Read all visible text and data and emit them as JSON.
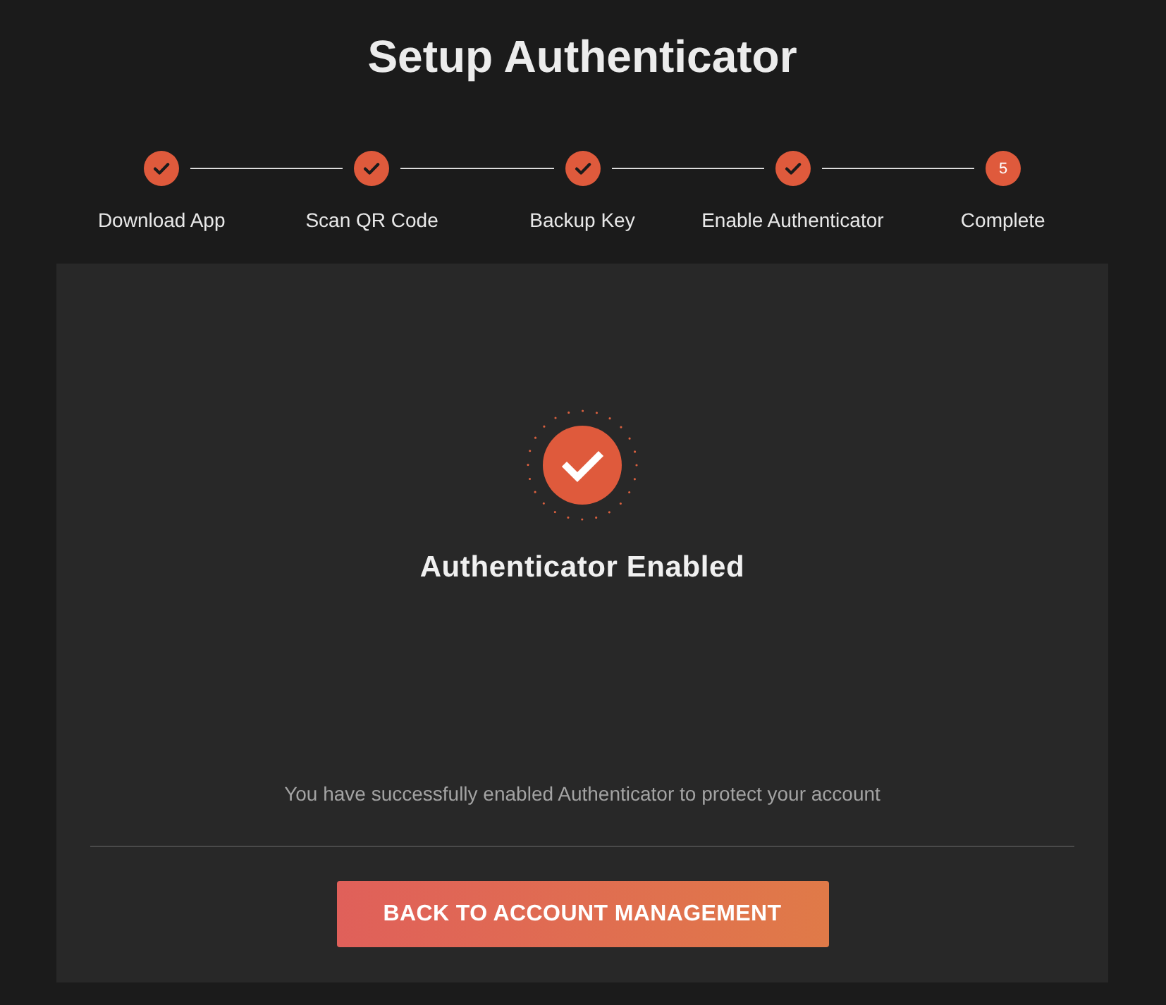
{
  "page": {
    "title": "Setup Authenticator"
  },
  "steps": [
    {
      "label": "Download App",
      "completed": true
    },
    {
      "label": "Scan QR Code",
      "completed": true
    },
    {
      "label": "Backup Key",
      "completed": true
    },
    {
      "label": "Enable Authenticator",
      "completed": true
    },
    {
      "label": "Complete",
      "completed": false,
      "number": "5"
    }
  ],
  "result": {
    "heading": "Authenticator Enabled",
    "message": "You have successfully enabled Authenticator to protect your account"
  },
  "actions": [
    {
      "label": "BACK TO ACCOUNT MANAGEMENT"
    }
  ]
}
